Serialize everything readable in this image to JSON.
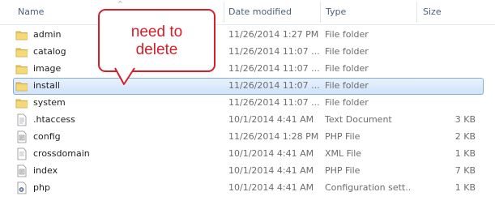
{
  "columns": {
    "name": "Name",
    "date_modified": "Date modified",
    "type": "Type",
    "size": "Size"
  },
  "annotation": {
    "line1": "need to",
    "line2": "delete",
    "border_color": "#d5202c"
  },
  "rows": [
    {
      "name": "admin",
      "date": "11/26/2014 1:27 PM",
      "type": "File folder",
      "size": "",
      "icon": "folder-icon"
    },
    {
      "name": "catalog",
      "date": "11/26/2014 11:07 ...",
      "type": "File folder",
      "size": "",
      "icon": "folder-icon"
    },
    {
      "name": "image",
      "date": "11/26/2014 11:07 ...",
      "type": "File folder",
      "size": "",
      "icon": "folder-icon"
    },
    {
      "name": "install",
      "date": "11/26/2014 11:07 ...",
      "type": "File folder",
      "size": "",
      "icon": "folder-icon",
      "selected": true
    },
    {
      "name": "system",
      "date": "11/26/2014 11:07 ...",
      "type": "File folder",
      "size": "",
      "icon": "folder-icon"
    },
    {
      "name": ".htaccess",
      "date": "10/1/2014 4:41 AM",
      "type": "Text Document",
      "size": "3 KB",
      "icon": "text-document-icon"
    },
    {
      "name": "config",
      "date": "11/26/2014 1:28 PM",
      "type": "PHP File",
      "size": "2 KB",
      "icon": "php-file-icon"
    },
    {
      "name": "crossdomain",
      "date": "10/1/2014 4:41 AM",
      "type": "XML File",
      "size": "1 KB",
      "icon": "xml-file-icon"
    },
    {
      "name": "index",
      "date": "10/1/2014 4:41 AM",
      "type": "PHP File",
      "size": "7 KB",
      "icon": "php-file-icon"
    },
    {
      "name": "php",
      "date": "10/1/2014 4:41 AM",
      "type": "Configuration sett...",
      "size": "1 KB",
      "icon": "config-settings-icon"
    }
  ],
  "colors": {
    "header_text": "#4c607a",
    "selection_border": "#84acdd",
    "selection_fill": "#cfe3f9",
    "folder": "#e8c65f"
  }
}
